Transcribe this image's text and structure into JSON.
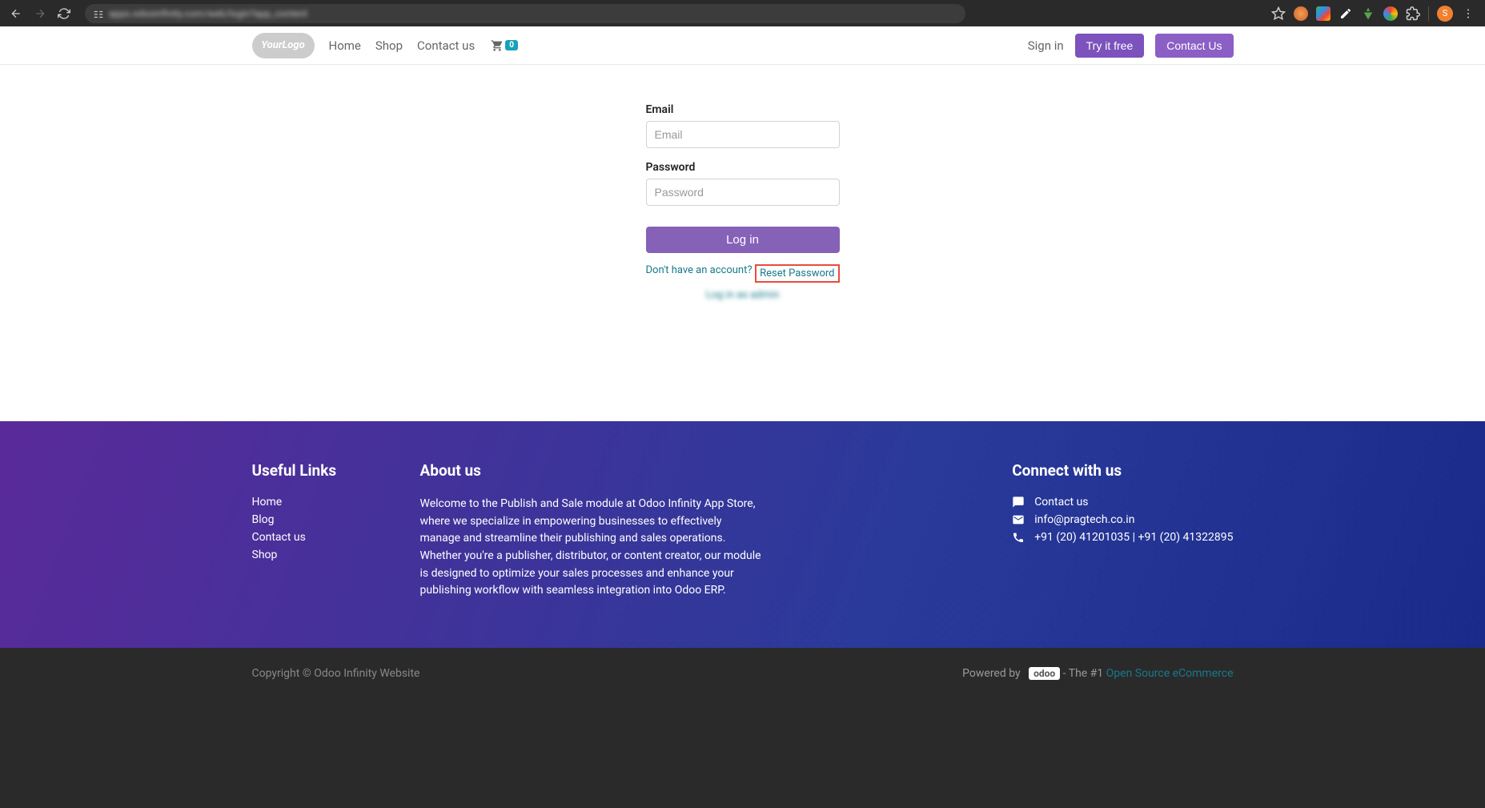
{
  "browser": {
    "url_blurred": "apps.odooinfinity.com/web/login?app_content",
    "avatar_letter": "S"
  },
  "logo": {
    "text": "YourLogo"
  },
  "nav": {
    "home": "Home",
    "shop": "Shop",
    "contact": "Contact us",
    "cart_count": "0",
    "signin": "Sign in",
    "try_free": "Try it free",
    "contact_us": "Contact Us"
  },
  "login": {
    "email_label": "Email",
    "email_placeholder": "Email",
    "password_label": "Password",
    "password_placeholder": "Password",
    "login_btn": "Log in",
    "no_account": "Don't have an account?",
    "reset_password": "Reset Password",
    "blurred_link": "Log in as admin"
  },
  "footer": {
    "useful_links": {
      "title": "Useful Links",
      "home": "Home",
      "blog": "Blog",
      "contact": "Contact us",
      "shop": "Shop"
    },
    "about": {
      "title": "About us",
      "text": "Welcome to the Publish and Sale module at Odoo Infinity App Store, where we specialize in empowering businesses to effectively manage and streamline their publishing and sales operations. Whether you're a publisher, distributor, or content creator, our module is designed to optimize your sales processes and enhance your publishing workflow with seamless integration into Odoo ERP."
    },
    "connect": {
      "title": "Connect with us",
      "contact": "Contact us",
      "email": "info@pragtech.co.in",
      "phone": "+91 (20) 41201035 | +91 (20) 41322895"
    }
  },
  "subfooter": {
    "copyright": "Copyright © Odoo Infinity Website",
    "powered_by": "Powered by",
    "odoo": "odoo",
    "the_n1": " - The #1 ",
    "ecommerce": "Open Source eCommerce"
  }
}
